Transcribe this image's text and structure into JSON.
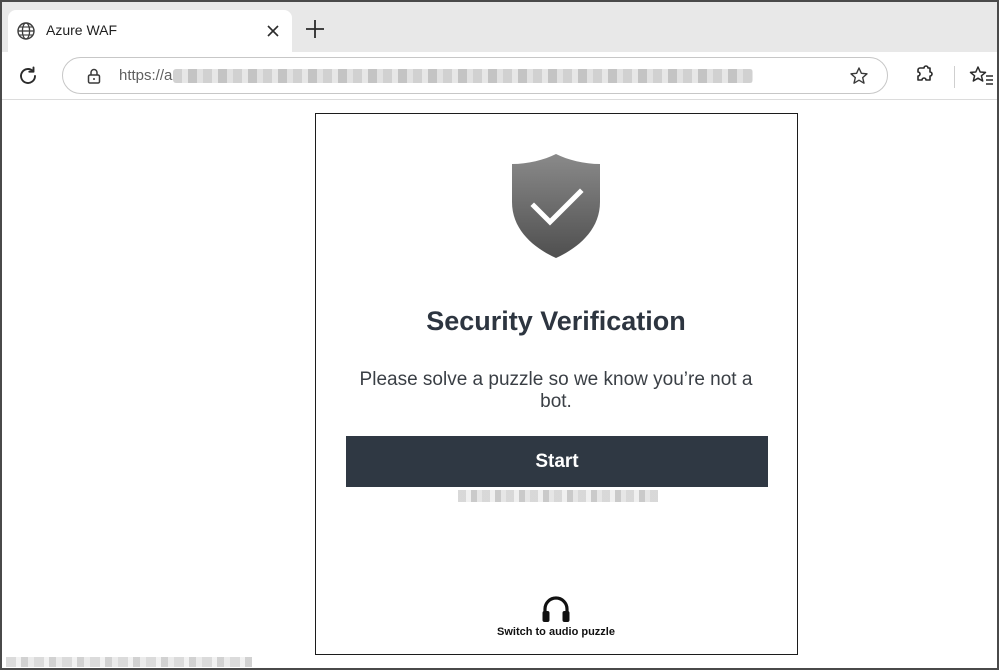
{
  "browser": {
    "tab": {
      "title": "Azure WAF",
      "favicon": "globe-icon"
    },
    "address_bar": {
      "url_prefix": "https://a"
    }
  },
  "verification": {
    "title": "Security Verification",
    "subtitle": "Please solve a puzzle so we know you’re not a bot.",
    "start_label": "Start",
    "audio_label": "Switch to audio puzzle"
  },
  "colors": {
    "button_bg": "#2f3843",
    "title_text": "#2d3540",
    "shield_top": "#8a8a8a",
    "shield_bottom": "#4f4f4f"
  }
}
